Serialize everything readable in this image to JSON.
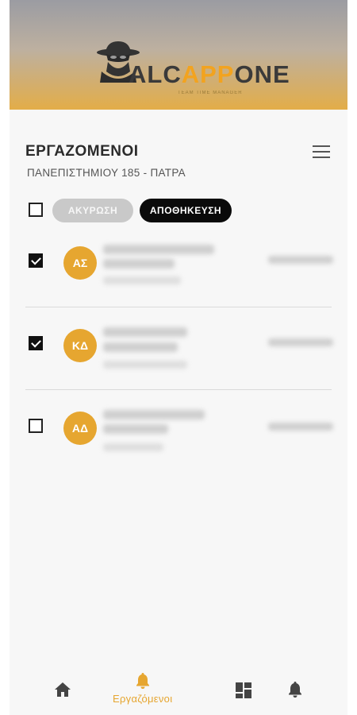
{
  "header": {
    "logo_text_dark": "ALC",
    "logo_text_accent": "APP",
    "logo_text_end": "ONE",
    "logo_tagline": "TEAM TIME MANAGER"
  },
  "page": {
    "title": "ΕΡΓΑΖΟΜΕΝΟΙ",
    "subtitle": "ΠΑΝΕΠΙΣΤΗΜΙΟΥ 185 - ΠΑΤΡΑ"
  },
  "actions": {
    "cancel_label": "ΑΚΥΡΩΣΗ",
    "save_label": "ΑΠΟΘΗΚΕΥΣΗ"
  },
  "employees": [
    {
      "initials": "ΑΣ",
      "checked": true
    },
    {
      "initials": "ΚΔ",
      "checked": true
    },
    {
      "initials": "ΑΔ",
      "checked": false
    }
  ],
  "bottom_nav": {
    "items": [
      {
        "icon": "home-icon"
      },
      {
        "icon": "bell-icon",
        "label": "Εργαζόμενοι",
        "active": true
      },
      {
        "icon": "dashboard-icon"
      },
      {
        "icon": "notification-icon"
      }
    ]
  },
  "colors": {
    "accent": "#e6a630",
    "save_button": "#0a0a0a",
    "cancel_button": "#c9c9c9"
  }
}
